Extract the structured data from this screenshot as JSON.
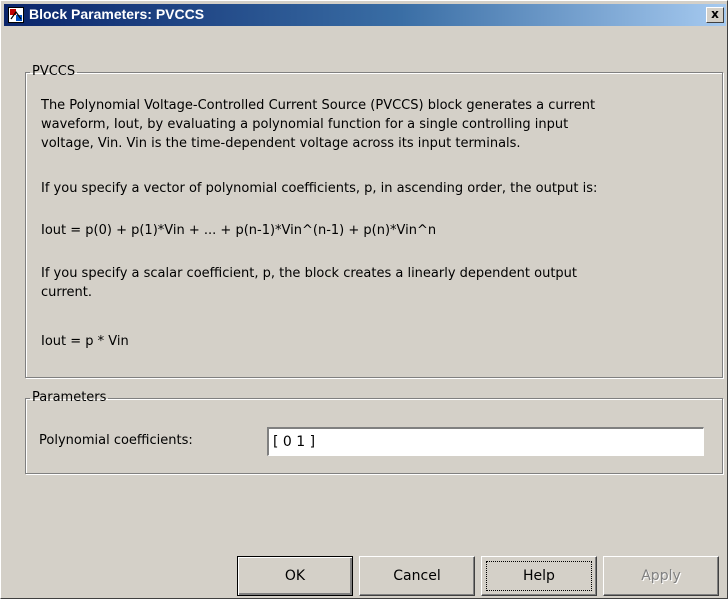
{
  "window": {
    "title": "Block Parameters: PVCCS",
    "close_label": "x",
    "app_icon": "simulink-block-icon"
  },
  "description_group": {
    "legend": "PVCCS",
    "paragraphs": [
      "The Polynomial Voltage-Controlled Current Source (PVCCS) block generates a current",
      "waveform, Iout, by evaluating a polynomial function for a single controlling input",
      "voltage, Vin. Vin is the time-dependent voltage across its input terminals.",
      "If you specify a vector of polynomial coefficients, p, in ascending order, the output is:",
      "Iout = p(0) + p(1)*Vin + ... + p(n-1)*Vin^(n-1) +  p(n)*Vin^n",
      "If you specify a scalar coefficient, p, the block creates a linearly dependent output",
      "current.",
      "Iout = p * Vin"
    ]
  },
  "parameters_group": {
    "legend": "Parameters",
    "coefficients_label": "Polynomial coefficients:",
    "coefficients_value": "[ 0 1 ]"
  },
  "buttons": {
    "ok": "OK",
    "cancel": "Cancel",
    "help": "Help",
    "apply": "Apply",
    "apply_enabled": false,
    "focused": "Help"
  },
  "colors": {
    "face": "#d4d0c8",
    "title_start": "#0a246a",
    "title_end": "#a6caf0",
    "disabled_text": "#808080"
  }
}
